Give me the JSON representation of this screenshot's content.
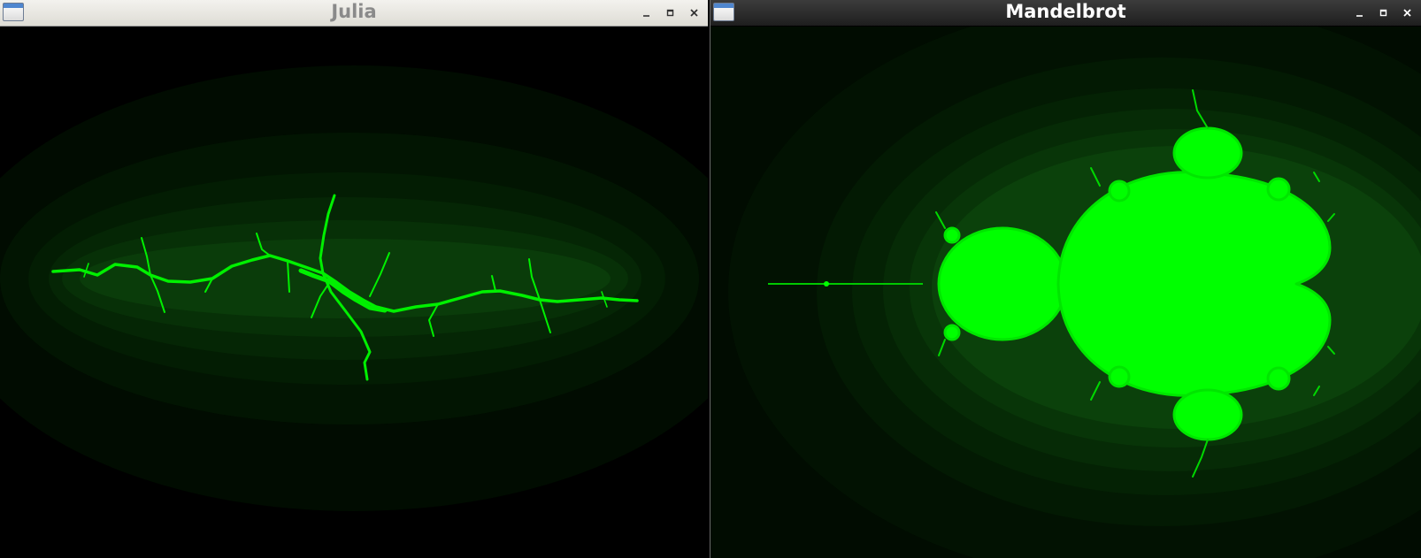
{
  "windows": {
    "julia": {
      "title": "Julia",
      "controls": {
        "minimize": "minimize-icon",
        "maximize": "maximize-icon",
        "close": "close-icon"
      }
    },
    "mandelbrot": {
      "title": "Mandelbrot",
      "controls": {
        "minimize": "minimize-icon",
        "maximize": "maximize-icon",
        "close": "close-icon"
      }
    }
  },
  "colors": {
    "fractal_green": "#00ff00",
    "background": "#000000",
    "light_titlebar": "#e6e4de",
    "dark_titlebar": "#2a2a2a"
  }
}
